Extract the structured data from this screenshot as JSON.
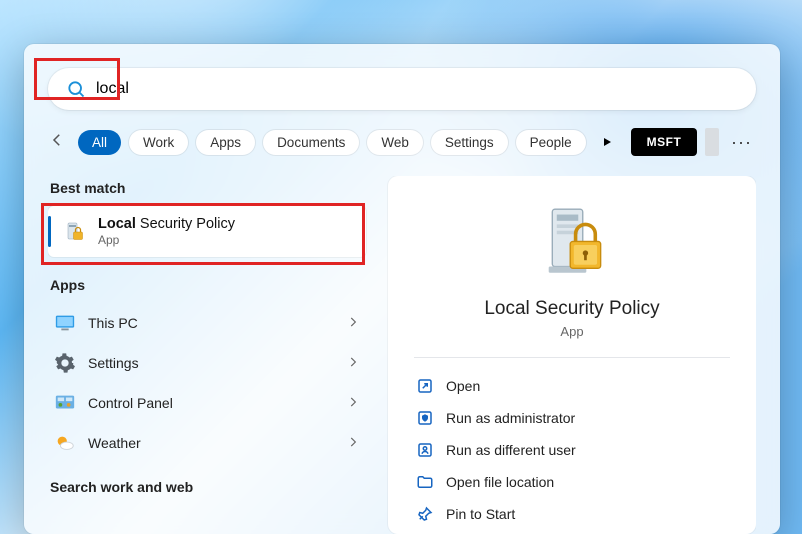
{
  "search": {
    "query": "local"
  },
  "filters": {
    "items": [
      {
        "label": "All",
        "active": true
      },
      {
        "label": "Work"
      },
      {
        "label": "Apps"
      },
      {
        "label": "Documents"
      },
      {
        "label": "Web"
      },
      {
        "label": "Settings"
      },
      {
        "label": "People"
      }
    ],
    "account_button": "MSFT"
  },
  "left": {
    "best_match_label": "Best match",
    "best_match": {
      "title_bold": "Local",
      "title_rest": " Security Policy",
      "subtitle": "App"
    },
    "apps_label": "Apps",
    "apps": [
      {
        "label": "This PC",
        "icon": "monitor"
      },
      {
        "label": "Settings",
        "icon": "gear"
      },
      {
        "label": "Control Panel",
        "icon": "panel"
      },
      {
        "label": "Weather",
        "icon": "weather"
      }
    ],
    "search_web_label": "Search work and web"
  },
  "right": {
    "title": "Local Security Policy",
    "subtitle": "App",
    "actions": [
      {
        "label": "Open",
        "icon": "open"
      },
      {
        "label": "Run as administrator",
        "icon": "shield"
      },
      {
        "label": "Run as different user",
        "icon": "user"
      },
      {
        "label": "Open file location",
        "icon": "folder"
      },
      {
        "label": "Pin to Start",
        "icon": "pin"
      }
    ]
  }
}
